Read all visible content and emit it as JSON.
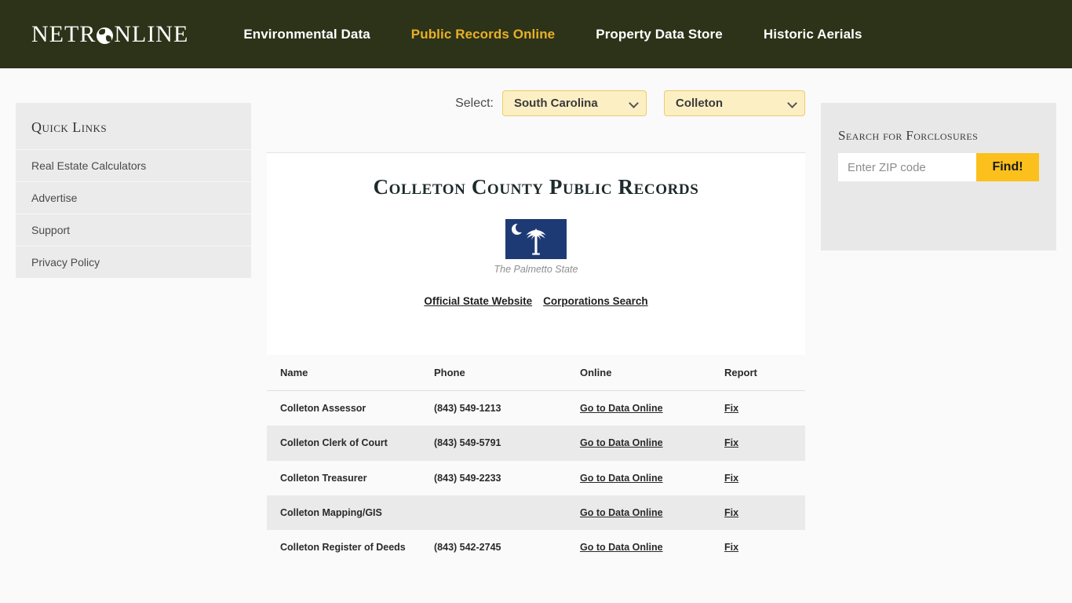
{
  "header": {
    "logo": {
      "text_before": "NETR",
      "icon": "globe-icon",
      "text_after": "NLINE"
    },
    "nav": [
      {
        "label": "Environmental Data",
        "active": false
      },
      {
        "label": "Public Records Online",
        "active": true
      },
      {
        "label": "Property Data Store",
        "active": false
      },
      {
        "label": "Historic Aerials",
        "active": false
      }
    ],
    "colors": {
      "background": "#2D3318",
      "active_link": "#E8B028",
      "link": "#FFFFFF"
    }
  },
  "left_sidebar": {
    "title": "Quick Links",
    "items": [
      {
        "label": "Real Estate Calculators"
      },
      {
        "label": "Advertise"
      },
      {
        "label": "Support"
      },
      {
        "label": "Privacy Policy"
      }
    ]
  },
  "selectors": {
    "label": "Select:",
    "state": {
      "value": "South Carolina",
      "icon": "chevron-down-icon"
    },
    "county": {
      "value": "Colleton",
      "icon": "chevron-down-icon"
    },
    "colors": {
      "fill": "#FCEFC4",
      "border": "#EBCD68"
    }
  },
  "main": {
    "title": "Colleton County Public Records",
    "flag": {
      "name": "south-carolina-flag",
      "caption": "The Palmetto State",
      "colors": {
        "field": "#1E3A74",
        "emblem": "#FFFFFF"
      }
    },
    "links": [
      {
        "label": "Official State Website"
      },
      {
        "label": "Corporations Search"
      }
    ]
  },
  "table": {
    "columns": [
      "Name",
      "Phone",
      "Online",
      "Report"
    ],
    "rows": [
      {
        "name": "Colleton Assessor",
        "phone": "(843) 549-1213",
        "online": "Go to Data Online",
        "report": "Fix"
      },
      {
        "name": "Colleton Clerk of Court",
        "phone": "(843) 549-5791",
        "online": "Go to Data Online",
        "report": "Fix"
      },
      {
        "name": "Colleton Treasurer",
        "phone": "(843) 549-2233",
        "online": "Go to Data Online",
        "report": "Fix"
      },
      {
        "name": "Colleton Mapping/GIS",
        "phone": "",
        "online": "Go to Data Online",
        "report": "Fix"
      },
      {
        "name": "Colleton Register of Deeds",
        "phone": "(843) 542-2745",
        "online": "Go to Data Online",
        "report": "Fix"
      }
    ]
  },
  "right_sidebar": {
    "title": "Search for Forclosures",
    "zip_input": {
      "value": "",
      "placeholder": "Enter ZIP code"
    },
    "find_button": {
      "label": "Find!",
      "color": "#FBC01C"
    }
  }
}
